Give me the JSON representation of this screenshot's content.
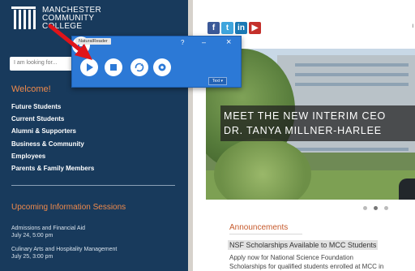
{
  "college": {
    "name_line1": "MANCHESTER",
    "name_line2": "COMMUNITY",
    "name_line3": "COLLEGE"
  },
  "search": {
    "placeholder": "I am looking for..."
  },
  "welcome": "Welcome!",
  "nav": [
    "Future Students",
    "Current Students",
    "Alumni & Supporters",
    "Business & Community",
    "Employees",
    "Parents & Family Members"
  ],
  "sessions": {
    "heading": "Upcoming Information Sessions",
    "events": [
      {
        "title": "Admissions and Financial Aid",
        "date": "July 24, 5:00 pm"
      },
      {
        "title": "Culinary Arts and Hospitality Management",
        "date": "July 25, 3:00 pm"
      }
    ]
  },
  "social": {
    "facebook": "f",
    "twitter": "t",
    "linkedin": "in",
    "youtube": "▶",
    "cut_text": "I"
  },
  "hero": {
    "line1": "MEET THE NEW INTERIM CEO",
    "line2": "DR. TANYA MILLNER-HARLEE"
  },
  "announcements": {
    "title": "Announcements",
    "headline": "NSF Scholarships Available to MCC Students",
    "body_line1": "Apply now for National Science Foundation",
    "body_line2": "Scholarships for qualified students enrolled at MCC in"
  },
  "reader": {
    "title": "NaturalReader",
    "help": "?",
    "minimize": "–",
    "close": "×",
    "text_label": "Text ▾"
  },
  "colors": {
    "sidebar_bg": "#183a5c",
    "accent_orange": "#f08a4b",
    "reader_blue": "#2c79d6",
    "arrow_red": "#e0141a"
  }
}
